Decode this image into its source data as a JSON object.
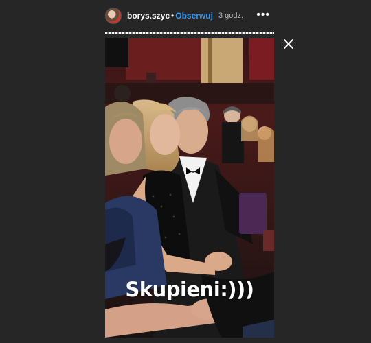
{
  "header": {
    "username": "borys.szyc",
    "separator": "•",
    "follow_label": "Obserwuj",
    "time_ago": "3 godz.",
    "more_icon": "more-horizontal-icon",
    "more_glyph": "•••"
  },
  "story": {
    "progress": 1.0,
    "caption": "Skupieni:)))"
  },
  "controls": {
    "close_icon": "close-icon"
  },
  "colors": {
    "background": "#262626",
    "link": "#3897f0",
    "text": "#ffffff"
  }
}
